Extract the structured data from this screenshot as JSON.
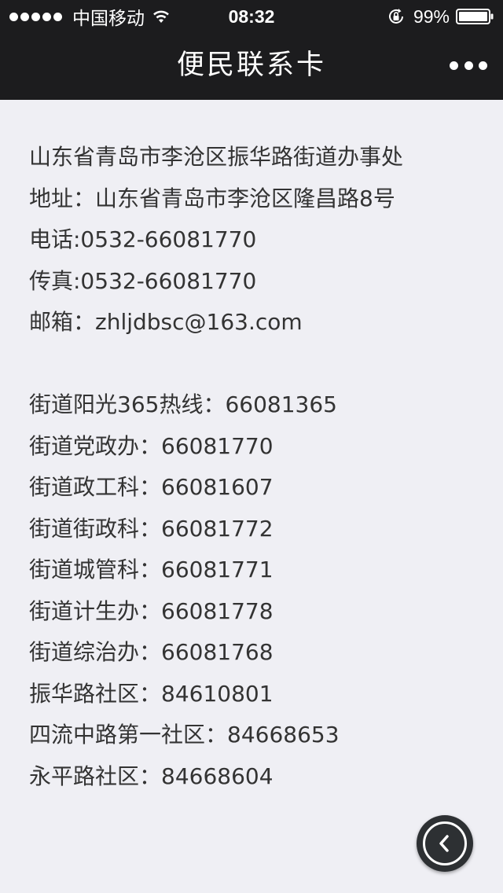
{
  "status_bar": {
    "carrier": "中国移动",
    "time": "08:32",
    "battery": "99%"
  },
  "nav": {
    "title": "便民联系卡"
  },
  "contact": {
    "org": "山东省青岛市李沧区振华路街道办事处",
    "address": "地址：山东省青岛市李沧区隆昌路8号",
    "phone": "电话:0532-66081770",
    "fax": "传真:0532-66081770",
    "email": "邮箱：zhljdbsc@163.com"
  },
  "hotlines": [
    "街道阳光365热线：66081365",
    "街道党政办：66081770",
    "街道政工科：66081607",
    "街道街政科：66081772",
    "街道城管科：66081771",
    "街道计生办：66081778",
    "街道综治办：66081768",
    "振华路社区：84610801",
    "四流中路第一社区：84668653",
    "永平路社区：84668604"
  ]
}
